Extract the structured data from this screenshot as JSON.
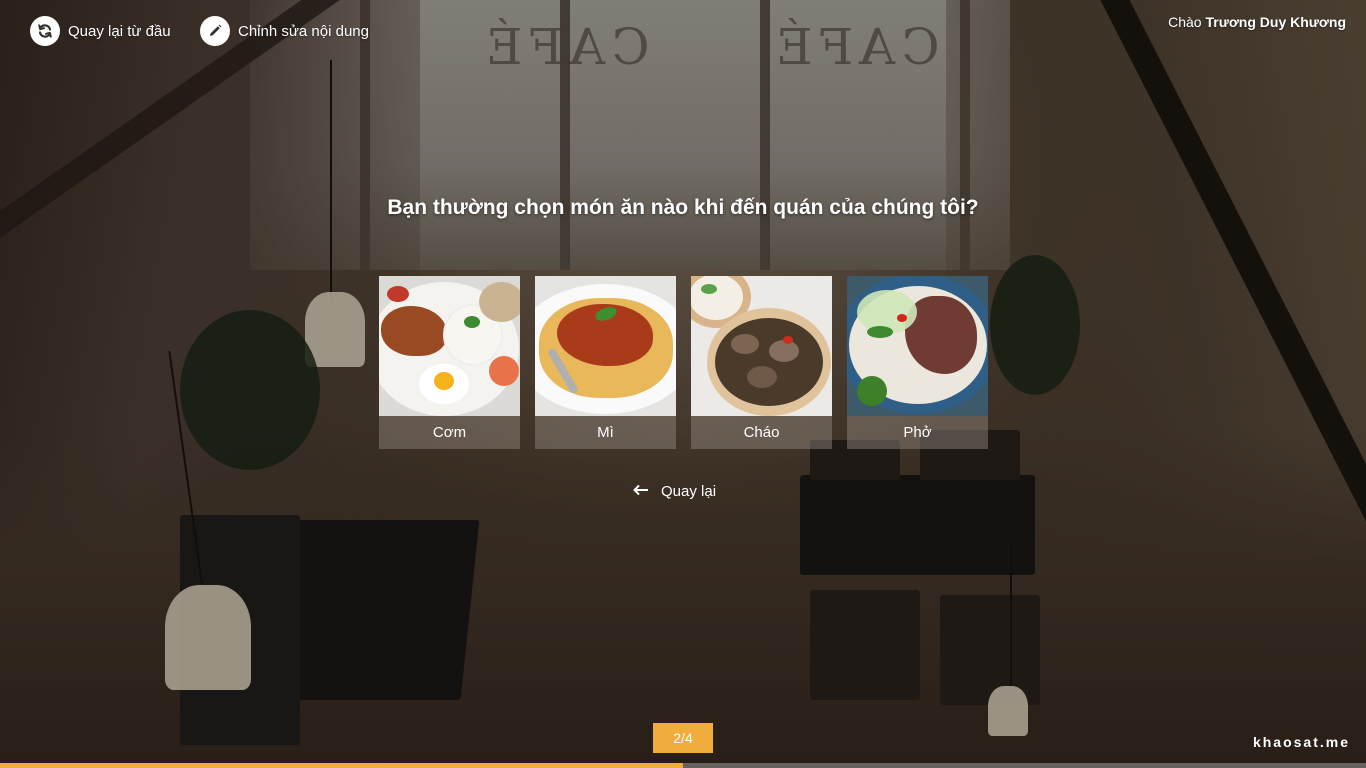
{
  "header": {
    "restart_label": "Quay lại từ đầu",
    "edit_label": "Chỉnh sửa nội dung",
    "greeting_prefix": "Chào",
    "user_name": "Trương Duy Khương"
  },
  "question": {
    "text": "Bạn thường chọn món ăn nào khi đến quán của chúng tôi?",
    "options": [
      {
        "label": "Cơm",
        "icon": "rice-plate-photo"
      },
      {
        "label": "Mì",
        "icon": "spaghetti-photo"
      },
      {
        "label": "Cháo",
        "icon": "porridge-photo"
      },
      {
        "label": "Phở",
        "icon": "pho-photo"
      }
    ]
  },
  "navigation": {
    "back_label": "Quay lại",
    "page_indicator": "2/4"
  },
  "progress": {
    "fraction": 0.5
  },
  "brand": {
    "text": "khaosat.me"
  },
  "colors": {
    "accent": "#f0ad3c",
    "text": "#ffffff"
  }
}
